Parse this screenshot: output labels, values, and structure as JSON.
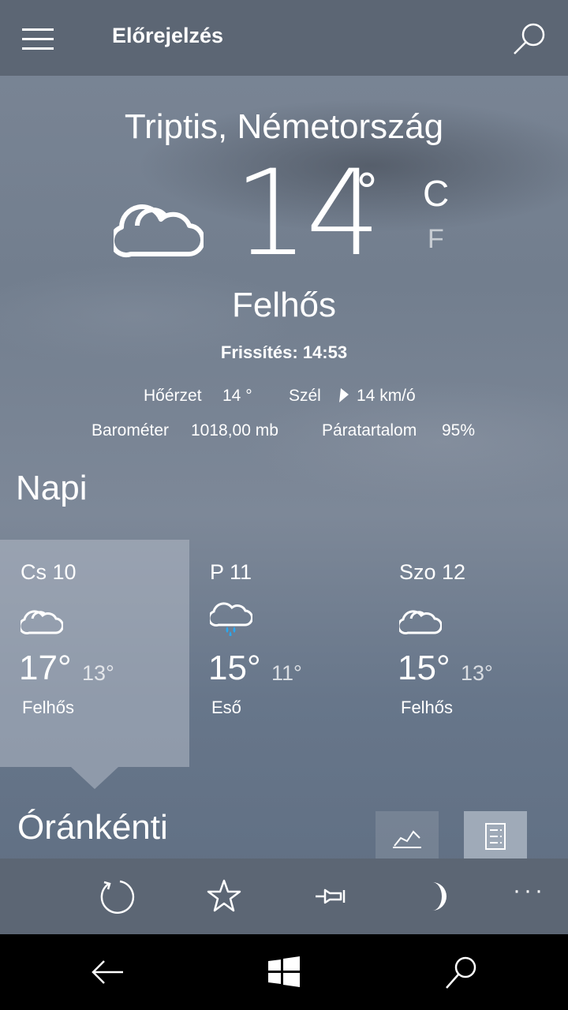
{
  "header": {
    "title": "Előrejelzés"
  },
  "current": {
    "location": "Triptis, Németország",
    "temperature": "14",
    "degree": "°",
    "unit_c": "C",
    "unit_f": "F",
    "condition": "Felhős",
    "updated": "Frissítés: 14:53",
    "feels_like_label": "Hőérzet",
    "feels_like_value": "14 °",
    "wind_label": "Szél",
    "wind_value": "14 km/ó",
    "barometer_label": "Barométer",
    "barometer_value": "1018,00 mb",
    "humidity_label": "Páratartalom",
    "humidity_value": "95%"
  },
  "daily": {
    "title": "Napi",
    "days": [
      {
        "name": "Cs 10",
        "hi": "17°",
        "lo": "13°",
        "condition": "Felhős",
        "icon": "cloud-icon"
      },
      {
        "name": "P 11",
        "hi": "15°",
        "lo": "11°",
        "condition": "Eső",
        "icon": "rain-icon"
      },
      {
        "name": "Szo 12",
        "hi": "15°",
        "lo": "13°",
        "condition": "Felhős",
        "icon": "cloud-icon"
      }
    ]
  },
  "hourly": {
    "title": "Óránkénti"
  },
  "appbar": {
    "more": "···"
  },
  "colors": {
    "topbar": "#5c6674",
    "selected_card": "rgba(178,186,198,0.55)",
    "navbar": "#000000"
  }
}
